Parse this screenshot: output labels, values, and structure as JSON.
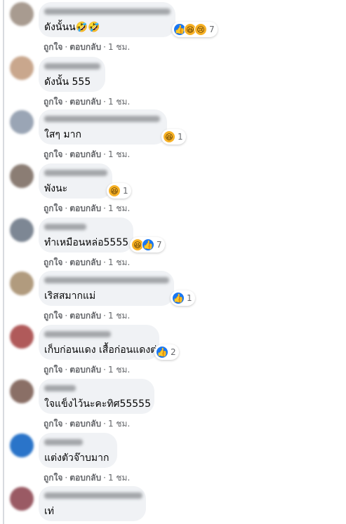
{
  "action_labels": {
    "like": "ถูกใจ",
    "reply": "ตอบกลับ",
    "time": "1 ชม."
  },
  "comments": [
    {
      "text": "ดังนั้นน🤣🤣",
      "reactions": [
        "like-icon",
        "haha-icon",
        "sad-icon"
      ],
      "count": "7",
      "avatar_color": "#a89b90"
    },
    {
      "text": "ดังนั้น 555",
      "reactions": [],
      "count": "",
      "avatar_color": "#c9a78d"
    },
    {
      "text": "ใสๆ มาก",
      "reactions": [
        "haha-icon"
      ],
      "count": "1",
      "avatar_color": "#9aa5b5"
    },
    {
      "text": "พังนะ",
      "reactions": [
        "haha-icon"
      ],
      "count": "1",
      "avatar_color": "#8b7d74"
    },
    {
      "text": "ทำเหมือนหล่อ5555",
      "reactions": [
        "haha-icon",
        "like-icon"
      ],
      "count": "7",
      "avatar_color": "#7d8794"
    },
    {
      "text": "เริสสมากแม่",
      "reactions": [
        "like-icon"
      ],
      "count": "1",
      "avatar_color": "#b19b7e"
    },
    {
      "text": "เก็บก่อนแดง เสื้อก่อนแดงต่ะ",
      "reactions": [
        "like-icon"
      ],
      "count": "2",
      "avatar_color": "#b05a5a"
    },
    {
      "text": "ใจแข็งไว้นะคะทิศ55555",
      "reactions": [],
      "count": "",
      "avatar_color": "#8a6f66"
    },
    {
      "text": "แต่งตัวจ๊าบมาก",
      "reactions": [],
      "count": "",
      "avatar_color": "#2a74c9"
    },
    {
      "text": "เท่",
      "reactions": [],
      "count": "",
      "avatar_color": "#9a5a64"
    }
  ]
}
